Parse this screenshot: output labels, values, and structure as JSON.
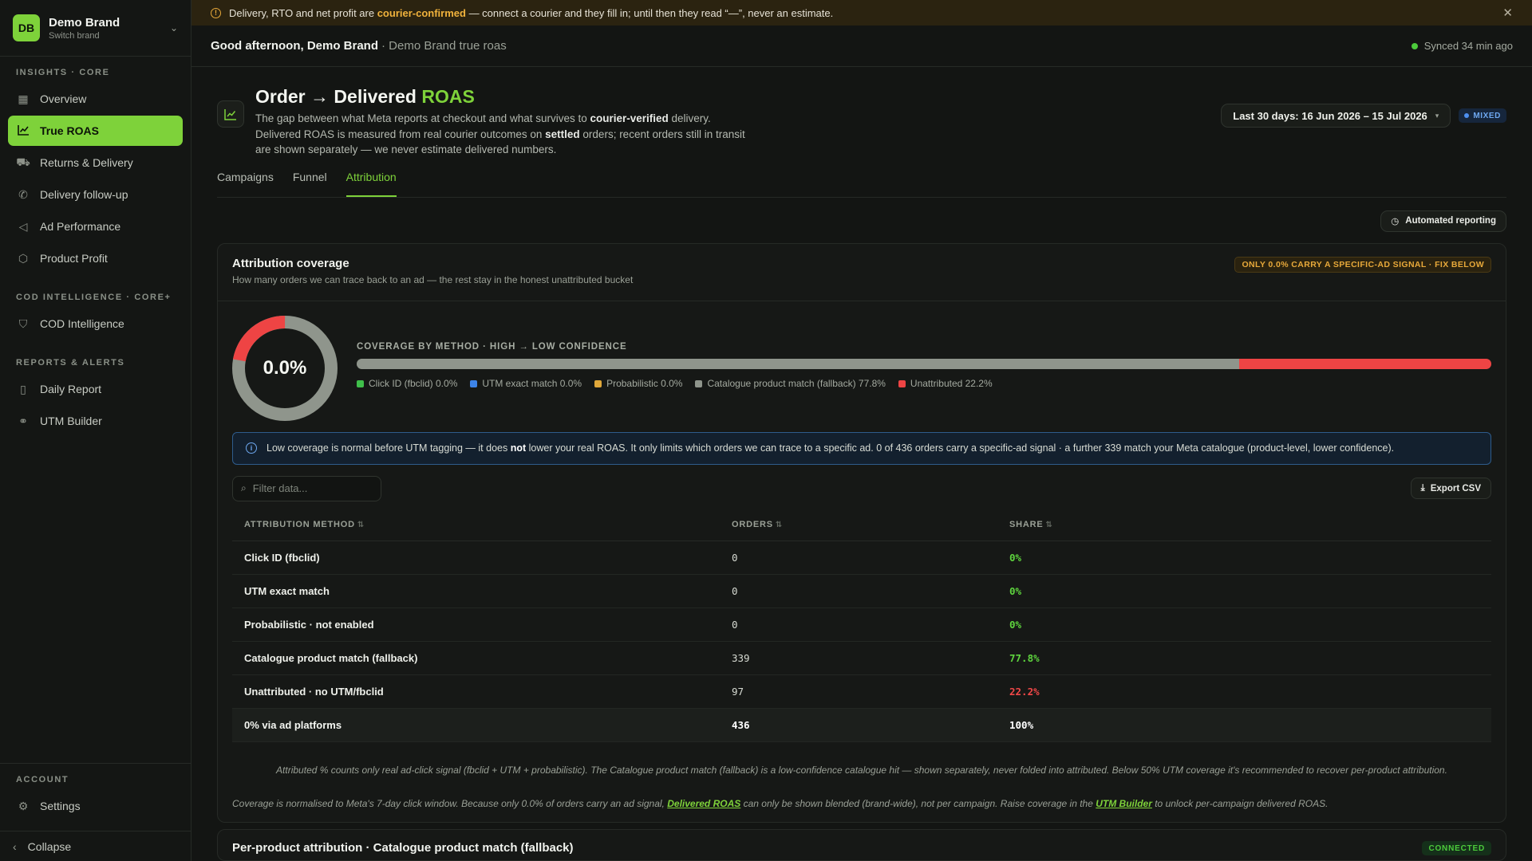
{
  "brand": {
    "initials": "DB",
    "name": "Demo Brand",
    "sub": "Switch brand"
  },
  "nav": {
    "sections": [
      {
        "label": "INSIGHTS · CORE",
        "items": [
          {
            "label": "Overview",
            "icon": "grid-icon"
          },
          {
            "label": "True ROAS",
            "icon": "chart-line-icon",
            "active": true
          },
          {
            "label": "Returns & Delivery",
            "icon": "truck-icon"
          },
          {
            "label": "Delivery follow-up",
            "icon": "phone-icon"
          },
          {
            "label": "Ad Performance",
            "icon": "megaphone-icon"
          },
          {
            "label": "Product Profit",
            "icon": "box-icon"
          }
        ]
      },
      {
        "label": "COD INTELLIGENCE · CORE+",
        "items": [
          {
            "label": "COD Intelligence",
            "icon": "shield-icon"
          }
        ]
      },
      {
        "label": "REPORTS & ALERTS",
        "items": [
          {
            "label": "Daily Report",
            "icon": "mobile-icon"
          },
          {
            "label": "UTM Builder",
            "icon": "link-icon"
          }
        ]
      }
    ],
    "account_label": "ACCOUNT",
    "settings": "Settings",
    "collapse": "Collapse"
  },
  "banner": {
    "pre": "Delivery, RTO and net profit are ",
    "strong": "courier-confirmed",
    "post": " — connect a courier and they fill in; until then they read “—”, never an estimate."
  },
  "topbar": {
    "greeting": "Good afternoon, Demo Brand",
    "sub": "· Demo Brand true roas",
    "synced": "Synced 34 min ago"
  },
  "header": {
    "title_main": "Order → Delivered ",
    "title_accent": "ROAS",
    "desc_1": "The gap between what Meta reports at checkout and what survives to ",
    "desc_b1": "courier-verified",
    "desc_2": " delivery. Delivered ROAS is measured from real courier outcomes on ",
    "desc_b2": "settled",
    "desc_3": " orders; recent orders still in transit are shown separately — we never estimate delivered numbers.",
    "date_range": "Last 30 days: 16 Jun 2026 – 15 Jul 2026",
    "mode_badge": "MIXED"
  },
  "tabs": [
    "Campaigns",
    "Funnel",
    "Attribution"
  ],
  "active_tab": 2,
  "auto_reporting": "Automated reporting",
  "coverage": {
    "title": "Attribution coverage",
    "sub": "How many orders we can trace back to an ad — the rest stay in the honest unattributed bucket",
    "warn": "ONLY 0.0% CARRY A SPECIFIC-AD SIGNAL · FIX BELOW",
    "pct_label": "0.0%",
    "methods_title": "COVERAGE BY METHOD · HIGH → LOW CONFIDENCE",
    "legend": [
      {
        "label": "Click ID (fbclid) 0.0%",
        "color": "#3fbf4a",
        "value": 0.0
      },
      {
        "label": "UTM exact match 0.0%",
        "color": "#3d84e8",
        "value": 0.0
      },
      {
        "label": "Probabilistic 0.0%",
        "color": "#e0a83a",
        "value": 0.0
      },
      {
        "label": "Catalogue product match (fallback) 77.8%",
        "color": "#8f958c",
        "value": 77.8
      },
      {
        "label": "Unattributed 22.2%",
        "color": "#ee4444",
        "value": 22.2
      }
    ]
  },
  "info": {
    "pre": "Low coverage is normal before UTM tagging — it does ",
    "bold": "not",
    "post": " lower your real ROAS. It only limits which orders we can trace to a specific ad. 0 of 436 orders carry a specific-ad signal · a further 339 match your Meta catalogue (product-level, lower confidence)."
  },
  "filter_placeholder": "Filter data...",
  "export_label": "Export CSV",
  "table": {
    "headers": [
      "ATTRIBUTION METHOD",
      "ORDERS",
      "SHARE"
    ],
    "rows": [
      {
        "method": "Click ID (fbclid)",
        "orders": "0",
        "share": "0%",
        "tone": "green"
      },
      {
        "method": "UTM exact match",
        "orders": "0",
        "share": "0%",
        "tone": "green"
      },
      {
        "method": "Probabilistic · not enabled",
        "orders": "0",
        "share": "0%",
        "tone": "green"
      },
      {
        "method": "Catalogue product match (fallback)",
        "orders": "339",
        "share": "77.8%",
        "tone": "green"
      },
      {
        "method": "Unattributed · no UTM/fbclid",
        "orders": "97",
        "share": "22.2%",
        "tone": "red"
      }
    ],
    "total": {
      "method": "0% via ad platforms",
      "orders": "436",
      "share": "100%"
    }
  },
  "footnote": "Attributed % counts only real ad-click signal (fbclid + UTM + probabilistic). The Catalogue product match (fallback) is a low-confidence catalogue hit — shown separately, never folded into attributed. Below 50% UTM coverage it's recommended to recover per-product attribution.",
  "footnote2": {
    "pre": "Coverage is normalised to Meta's 7-day click window. Because only 0.0% of orders carry an ad signal, ",
    "link1": "Delivered ROAS",
    "mid": " can only be shown blended (brand-wide), not per campaign. Raise coverage in the ",
    "link2": "UTM Builder",
    "post": " to unlock per-campaign delivered ROAS."
  },
  "next_card": {
    "title": "Per-product attribution · Catalogue product match (fallback)",
    "badge": "CONNECTED"
  }
}
